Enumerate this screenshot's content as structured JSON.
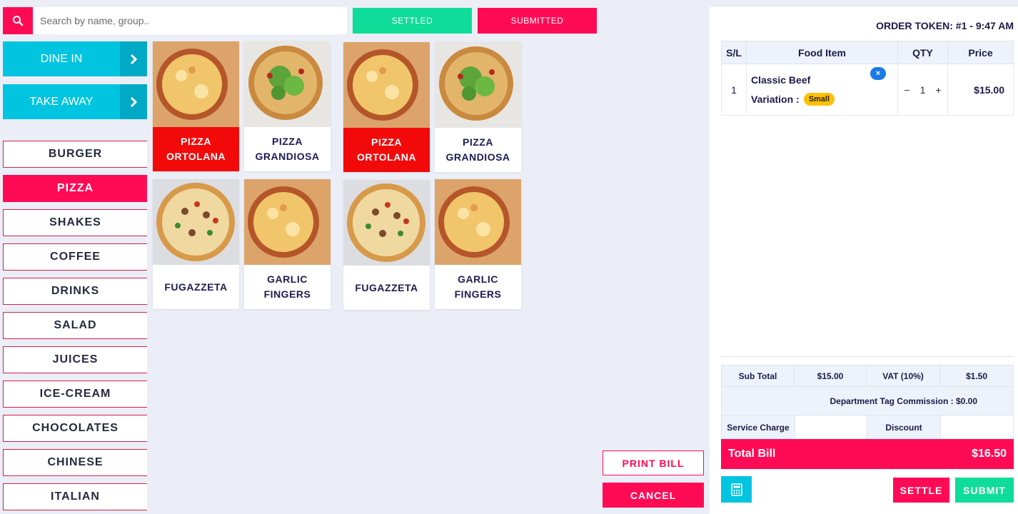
{
  "search": {
    "placeholder": "Search by name, group.."
  },
  "top_buttons": {
    "settled": "SETTLED",
    "submitted": "SUBMITTED"
  },
  "order_types": [
    {
      "label": "DINE IN"
    },
    {
      "label": "TAKE AWAY"
    }
  ],
  "categories": [
    {
      "label": "BURGER"
    },
    {
      "label": "PIZZA",
      "active": true
    },
    {
      "label": "SHAKES"
    },
    {
      "label": "COFFEE"
    },
    {
      "label": "DRINKS"
    },
    {
      "label": "SALAD"
    },
    {
      "label": "JUICES"
    },
    {
      "label": "ICE-CREAM"
    },
    {
      "label": "CHOCOLATES"
    },
    {
      "label": "CHINESE"
    },
    {
      "label": "ITALIAN"
    }
  ],
  "products": [
    {
      "name": "PIZZA ORTOLANA",
      "image": "cheese-pizza-slice",
      "highlight": true
    },
    {
      "name": "PIZZA GRANDIOSA",
      "image": "arugula-pizza",
      "highlight": false
    },
    {
      "name": "PIZZA ORTOLANA",
      "image": "cheese-pizza-slice",
      "highlight": true
    },
    {
      "name": "PIZZA GRANDIOSA",
      "image": "arugula-pizza",
      "highlight": false
    },
    {
      "name": "FUGAZZETA",
      "image": "veggie-pizza",
      "highlight": false
    },
    {
      "name": "GARLIC FINGERS",
      "image": "cheese-pizza-slice",
      "highlight": false
    },
    {
      "name": "FUGAZZETA",
      "image": "veggie-pizza",
      "highlight": false
    },
    {
      "name": "GARLIC FINGERS",
      "image": "cheese-pizza-slice",
      "highlight": false
    }
  ],
  "bill_actions": {
    "print": "PRINT BILL",
    "cancel": "CANCEL"
  },
  "order": {
    "token": "ORDER TOKEN: #1 - 9:47 AM",
    "headers": {
      "sl": "S/L",
      "item": "Food Item",
      "qty": "QTY",
      "price": "Price"
    },
    "items": [
      {
        "sl": "1",
        "name": "Classic Beef",
        "variation_label": "Variation :",
        "variation": "Small",
        "qty": "1",
        "price": "$15.00"
      }
    ],
    "remove_glyph": "×",
    "minus_glyph": "−",
    "plus_glyph": "+"
  },
  "totals": {
    "subtotal_label": "Sub Total",
    "subtotal": "$15.00",
    "vat_label": "VAT (10%)",
    "vat": "$1.50",
    "dept_commission": "Department Tag Commission : $0.00",
    "service_charge_label": "Service Charge",
    "discount_label": "Discount",
    "total_label": "Total Bill",
    "total": "$16.50"
  },
  "footer_buttons": {
    "settle": "SETTLE",
    "submit": "SUBMIT"
  },
  "colors": {
    "pink": "#ff0b55",
    "green": "#0fdc98",
    "cyan": "#00c4e0",
    "red": "#f20a0a",
    "navy": "#1b1a4a"
  },
  "icons": {
    "search": "search-icon",
    "arrow": "chevron-right-icon",
    "calculator": "calculator-icon"
  }
}
